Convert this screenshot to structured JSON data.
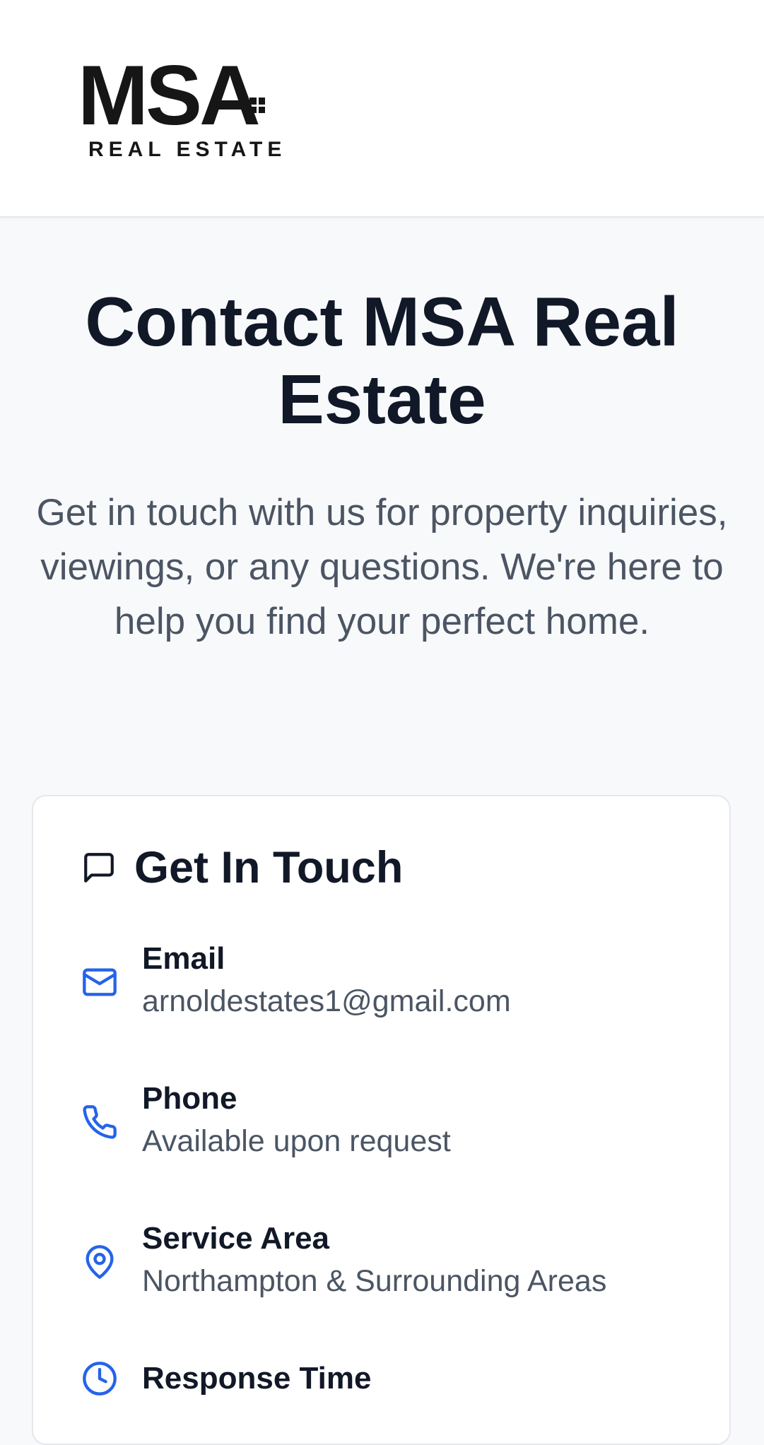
{
  "logo": {
    "mark": "MSA",
    "subtitle": "REAL ESTATE"
  },
  "hero": {
    "title": "Contact MSA Real Estate",
    "subtitle": "Get in touch with us for property inquiries, viewings, or any questions. We're here to help you find your perfect home."
  },
  "card": {
    "title": "Get In Touch",
    "icon": "message-square-icon",
    "items": [
      {
        "label": "Email",
        "value": "arnoldestates1@gmail.com",
        "icon": "mail-icon"
      },
      {
        "label": "Phone",
        "value": "Available upon request",
        "icon": "phone-icon"
      },
      {
        "label": "Service Area",
        "value": "Northampton & Surrounding Areas",
        "icon": "map-pin-icon"
      },
      {
        "label": "Response Time",
        "value": "",
        "icon": "clock-icon"
      }
    ]
  },
  "colors": {
    "accent": "#2563eb",
    "text": "#111827",
    "muted": "#4b5563",
    "page_bg": "#f8f9fb"
  }
}
